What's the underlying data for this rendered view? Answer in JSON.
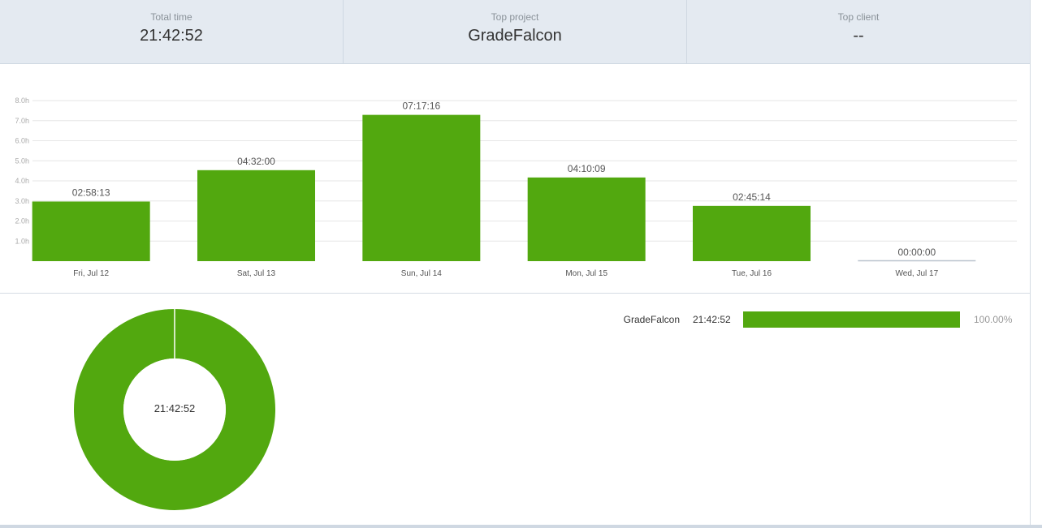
{
  "summary": {
    "total_time_label": "Total time",
    "total_time_value": "21:42:52",
    "top_project_label": "Top project",
    "top_project_value": "GradeFalcon",
    "top_client_label": "Top client",
    "top_client_value": "--"
  },
  "colors": {
    "bar": "#52a80f",
    "grid": "#e6e6e6",
    "axis": "#cfd8e2"
  },
  "chart_data": {
    "type": "bar",
    "categories": [
      "Fri, Jul 12",
      "Sat, Jul 13",
      "Sun, Jul 14",
      "Mon, Jul 15",
      "Tue, Jul 16",
      "Wed, Jul 17"
    ],
    "values": [
      2.9703,
      4.5333,
      7.2878,
      4.1692,
      2.7539,
      0
    ],
    "labels": [
      "02:58:13",
      "04:32:00",
      "07:17:16",
      "04:10:09",
      "02:45:14",
      "00:00:00"
    ],
    "ylim": [
      0,
      8
    ],
    "yticks": [
      "1.0h",
      "2.0h",
      "3.0h",
      "4.0h",
      "5.0h",
      "6.0h",
      "7.0h",
      "8.0h"
    ],
    "grid": true
  },
  "donut": {
    "center_label": "21:42:52",
    "segments": [
      {
        "name": "GradeFalcon",
        "value": 100
      }
    ]
  },
  "legend": [
    {
      "name": "GradeFalcon",
      "time": "21:42:52",
      "percent": "100.00%",
      "fraction": 1.0
    }
  ]
}
